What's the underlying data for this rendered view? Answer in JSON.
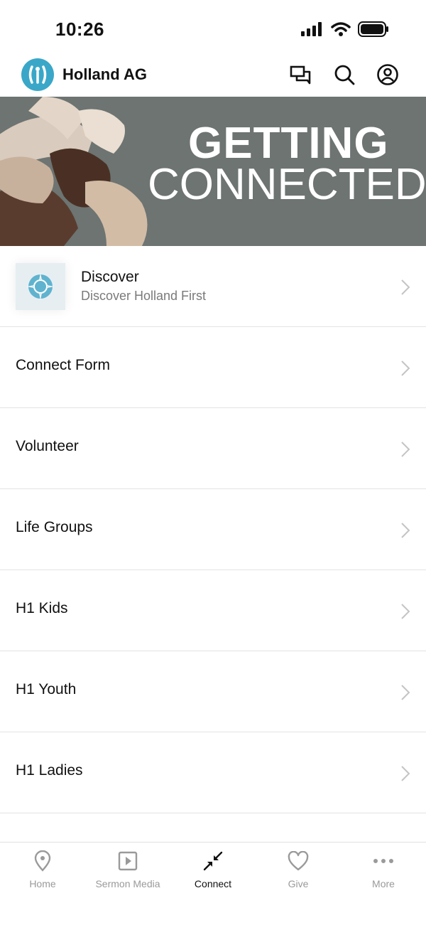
{
  "status_bar": {
    "time": "10:26"
  },
  "header": {
    "title": "Holland AG"
  },
  "banner": {
    "line1": "GETTING",
    "line2": "CONNECTED"
  },
  "list": {
    "discover": {
      "title": "Discover",
      "subtitle": "Discover Holland First"
    },
    "items": [
      {
        "label": "Connect Form"
      },
      {
        "label": "Volunteer"
      },
      {
        "label": "Life Groups"
      },
      {
        "label": "H1 Kids"
      },
      {
        "label": "H1 Youth"
      },
      {
        "label": "H1 Ladies"
      }
    ]
  },
  "tabbar": {
    "tabs": [
      {
        "label": "Home",
        "icon": "location-pin-icon"
      },
      {
        "label": "Sermon Media",
        "icon": "play-icon"
      },
      {
        "label": "Connect",
        "icon": "connect-arrows-icon",
        "active": true
      },
      {
        "label": "Give",
        "icon": "heart-icon"
      },
      {
        "label": "More",
        "icon": "more-dots-icon"
      }
    ]
  },
  "colors": {
    "accent": "#3aa7c8",
    "banner_bg": "#6d7472",
    "inactive": "#9a9a9a"
  }
}
